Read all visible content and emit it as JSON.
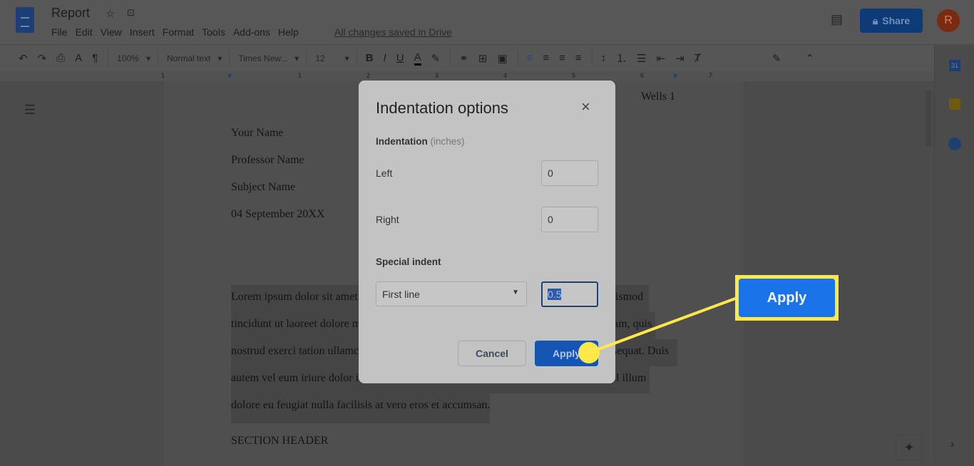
{
  "app": {
    "title": "Report",
    "menu": [
      "File",
      "Edit",
      "View",
      "Insert",
      "Format",
      "Tools",
      "Add-ons",
      "Help"
    ],
    "save_status": "All changes saved in Drive",
    "share_label": "Share",
    "avatar_initial": "R"
  },
  "toolbar": {
    "zoom": "100%",
    "style": "Normal text",
    "font": "Times New...",
    "size": "12"
  },
  "ruler": [
    "1",
    "1",
    "2",
    "3",
    "4",
    "5",
    "6",
    "7"
  ],
  "document": {
    "header": "Wells 1",
    "lines": [
      "Your Name",
      "Professor Name",
      "Subject Name",
      "04 September 20XX"
    ],
    "paragraph": [
      "Lorem ipsum dolor sit amet",
      "uismod",
      "tincidunt ut laoreet dolore m",
      "am, quis",
      "nostrud exerci tation ullamc",
      "sequat. Duis",
      "autem vel eum iriure dolor i",
      "el illum",
      "dolore eu feugiat nulla facilisis at vero eros et accumsan."
    ],
    "section_header": "SECTION HEADER"
  },
  "dialog": {
    "title": "Indentation options",
    "indentation_label": "Indentation",
    "units": "(inches)",
    "left_label": "Left",
    "left_value": "0",
    "right_label": "Right",
    "right_value": "0",
    "special_label": "Special indent",
    "special_value": "First line",
    "special_amount": "0.5",
    "cancel": "Cancel",
    "apply": "Apply"
  },
  "callout": {
    "label": "Apply",
    "color": "#ffe94a"
  },
  "colors": {
    "accent": "#1a73e8",
    "highlight": "#ffe94a"
  }
}
